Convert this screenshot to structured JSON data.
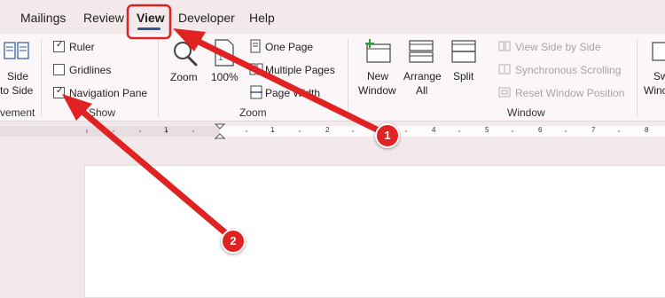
{
  "tabs": [
    "Mailings",
    "Review",
    "View",
    "Developer",
    "Help"
  ],
  "active_tab": "View",
  "window_group": {
    "side_by_side_line1": "Side",
    "side_by_side_line2": "to Side",
    "label_fragment": "vement"
  },
  "show_group": {
    "label_fragment": "Show",
    "ruler": {
      "label": "Ruler",
      "checked": true
    },
    "gridlines": {
      "label": "Gridlines",
      "checked": false
    },
    "navigation_pane": {
      "label": "Navigation Pane",
      "checked": true
    }
  },
  "zoom_group": {
    "label": "Zoom",
    "zoom_button": "Zoom",
    "percent_button": "100%",
    "one_page": "One Page",
    "multiple_pages": "Multiple Pages",
    "page_width": "Page Width"
  },
  "window_panel": {
    "label": "Window",
    "new_window_line1": "New",
    "new_window_line2": "Window",
    "arrange_all_line1": "Arrange",
    "arrange_all_line2": "All",
    "split": "Split",
    "view_side_by_side": "View Side by Side",
    "synchronous_scrolling": "Synchronous Scrolling",
    "reset_window_position": "Reset Window Position",
    "switch_windows_line1": "Sw",
    "switch_windows_line2": "Winc"
  },
  "ruler_numbers": [
    "1",
    "1",
    "2",
    "3",
    "4",
    "5",
    "6",
    "7",
    "8",
    "9",
    "10"
  ],
  "annotations": {
    "badge1": "1",
    "badge2": "2"
  },
  "colors": {
    "accent": "#2b579a",
    "annotation": "#e02222",
    "highlight_border": "#e02222"
  }
}
